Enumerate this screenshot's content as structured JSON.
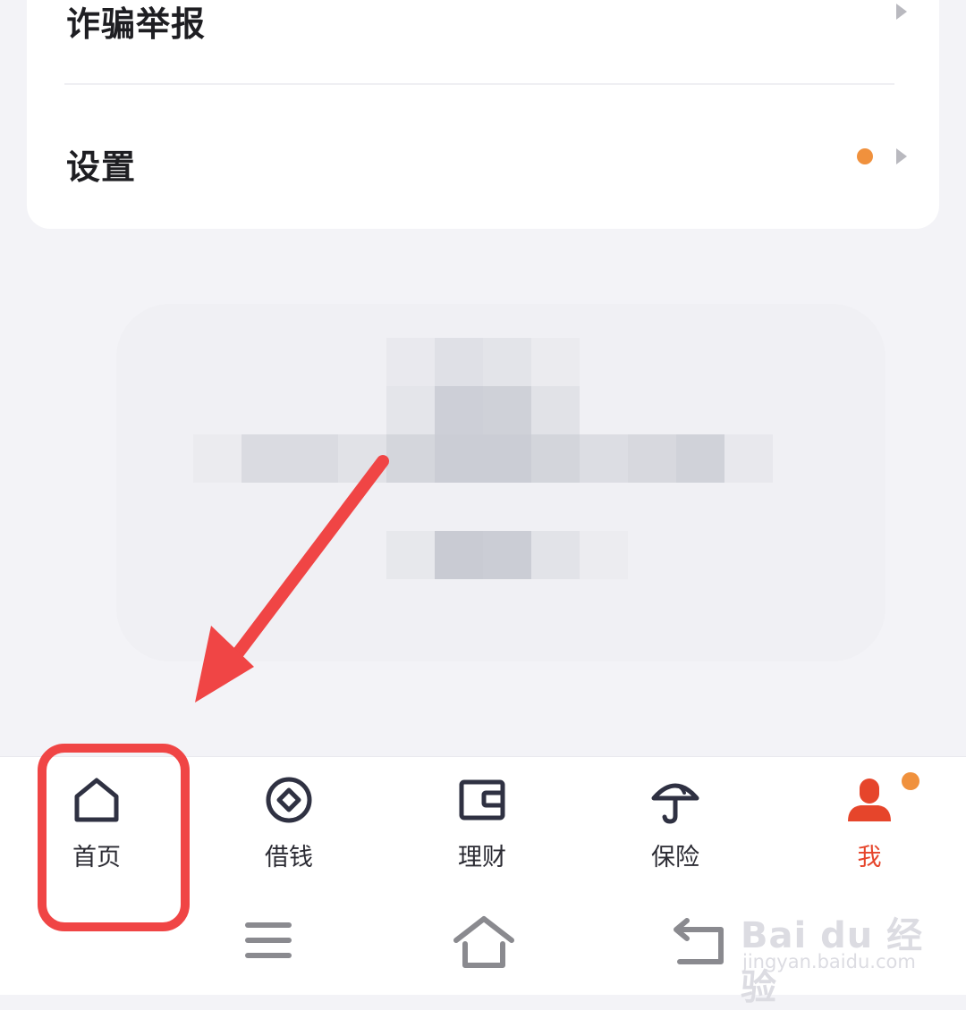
{
  "menu": {
    "items": [
      {
        "label": "诈骗举报"
      },
      {
        "label": "设置"
      }
    ]
  },
  "tabbar": {
    "tabs": [
      {
        "label": "首页",
        "icon": "home-icon"
      },
      {
        "label": "借钱",
        "icon": "coin-icon"
      },
      {
        "label": "理财",
        "icon": "wallet-icon"
      },
      {
        "label": "保险",
        "icon": "umbrella-icon"
      },
      {
        "label": "我",
        "icon": "person-icon"
      }
    ],
    "active_color": "#e6452b",
    "badge_color": "#f0913d"
  },
  "annotation": {
    "highlight_color": "#f04545"
  },
  "watermark": {
    "main": "Bai du 经验",
    "sub": "jingyan.baidu.com"
  }
}
